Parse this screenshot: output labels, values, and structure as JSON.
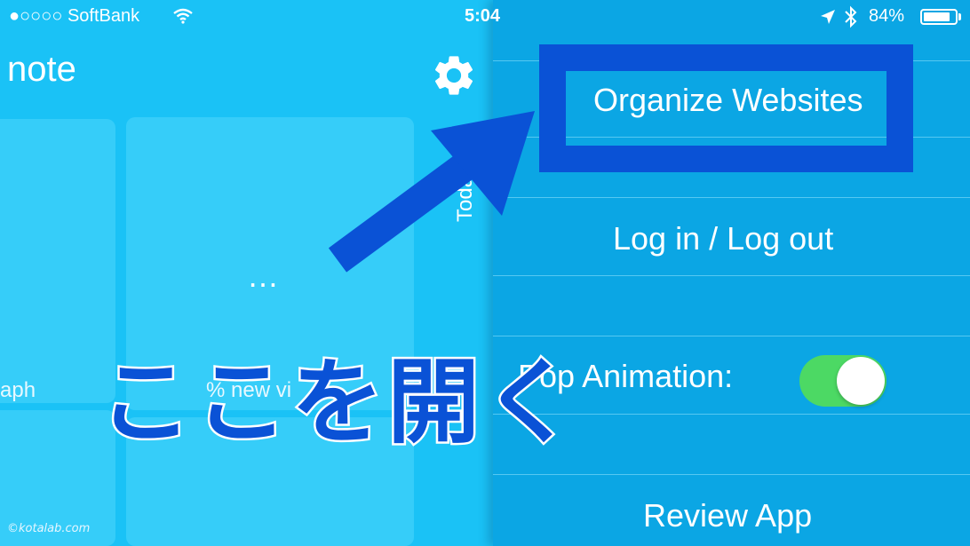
{
  "status_bar": {
    "carrier": "●○○○○ SoftBank",
    "time": "5:04",
    "battery_percent": "84%",
    "battery_level": 0.84,
    "icons": [
      "wifi-icon",
      "location-arrow-icon",
      "bluetooth-icon",
      "battery-icon"
    ]
  },
  "app": {
    "title": "note",
    "settings_icon": "gear-icon",
    "tiles": {
      "dots": "…",
      "graph_label": "aph",
      "percent_label": "% new vi"
    },
    "side_label": "Toda"
  },
  "menu": {
    "organize_websites": "Organize Websites",
    "login_logout": "Log in / Log out",
    "pop_animation_label": "Pop Animation:",
    "pop_animation_on": true,
    "review_app": "Review App"
  },
  "annotation": {
    "caption": "ここを開く",
    "arrow_icon": "pointer-arrow-icon"
  },
  "watermark": "©kotalab.com",
  "colors": {
    "menu_bg": "#0ba6e4",
    "app_bg": "#1ac2f6",
    "highlight": "#0a52d6",
    "toggle_on": "#4cd964"
  }
}
